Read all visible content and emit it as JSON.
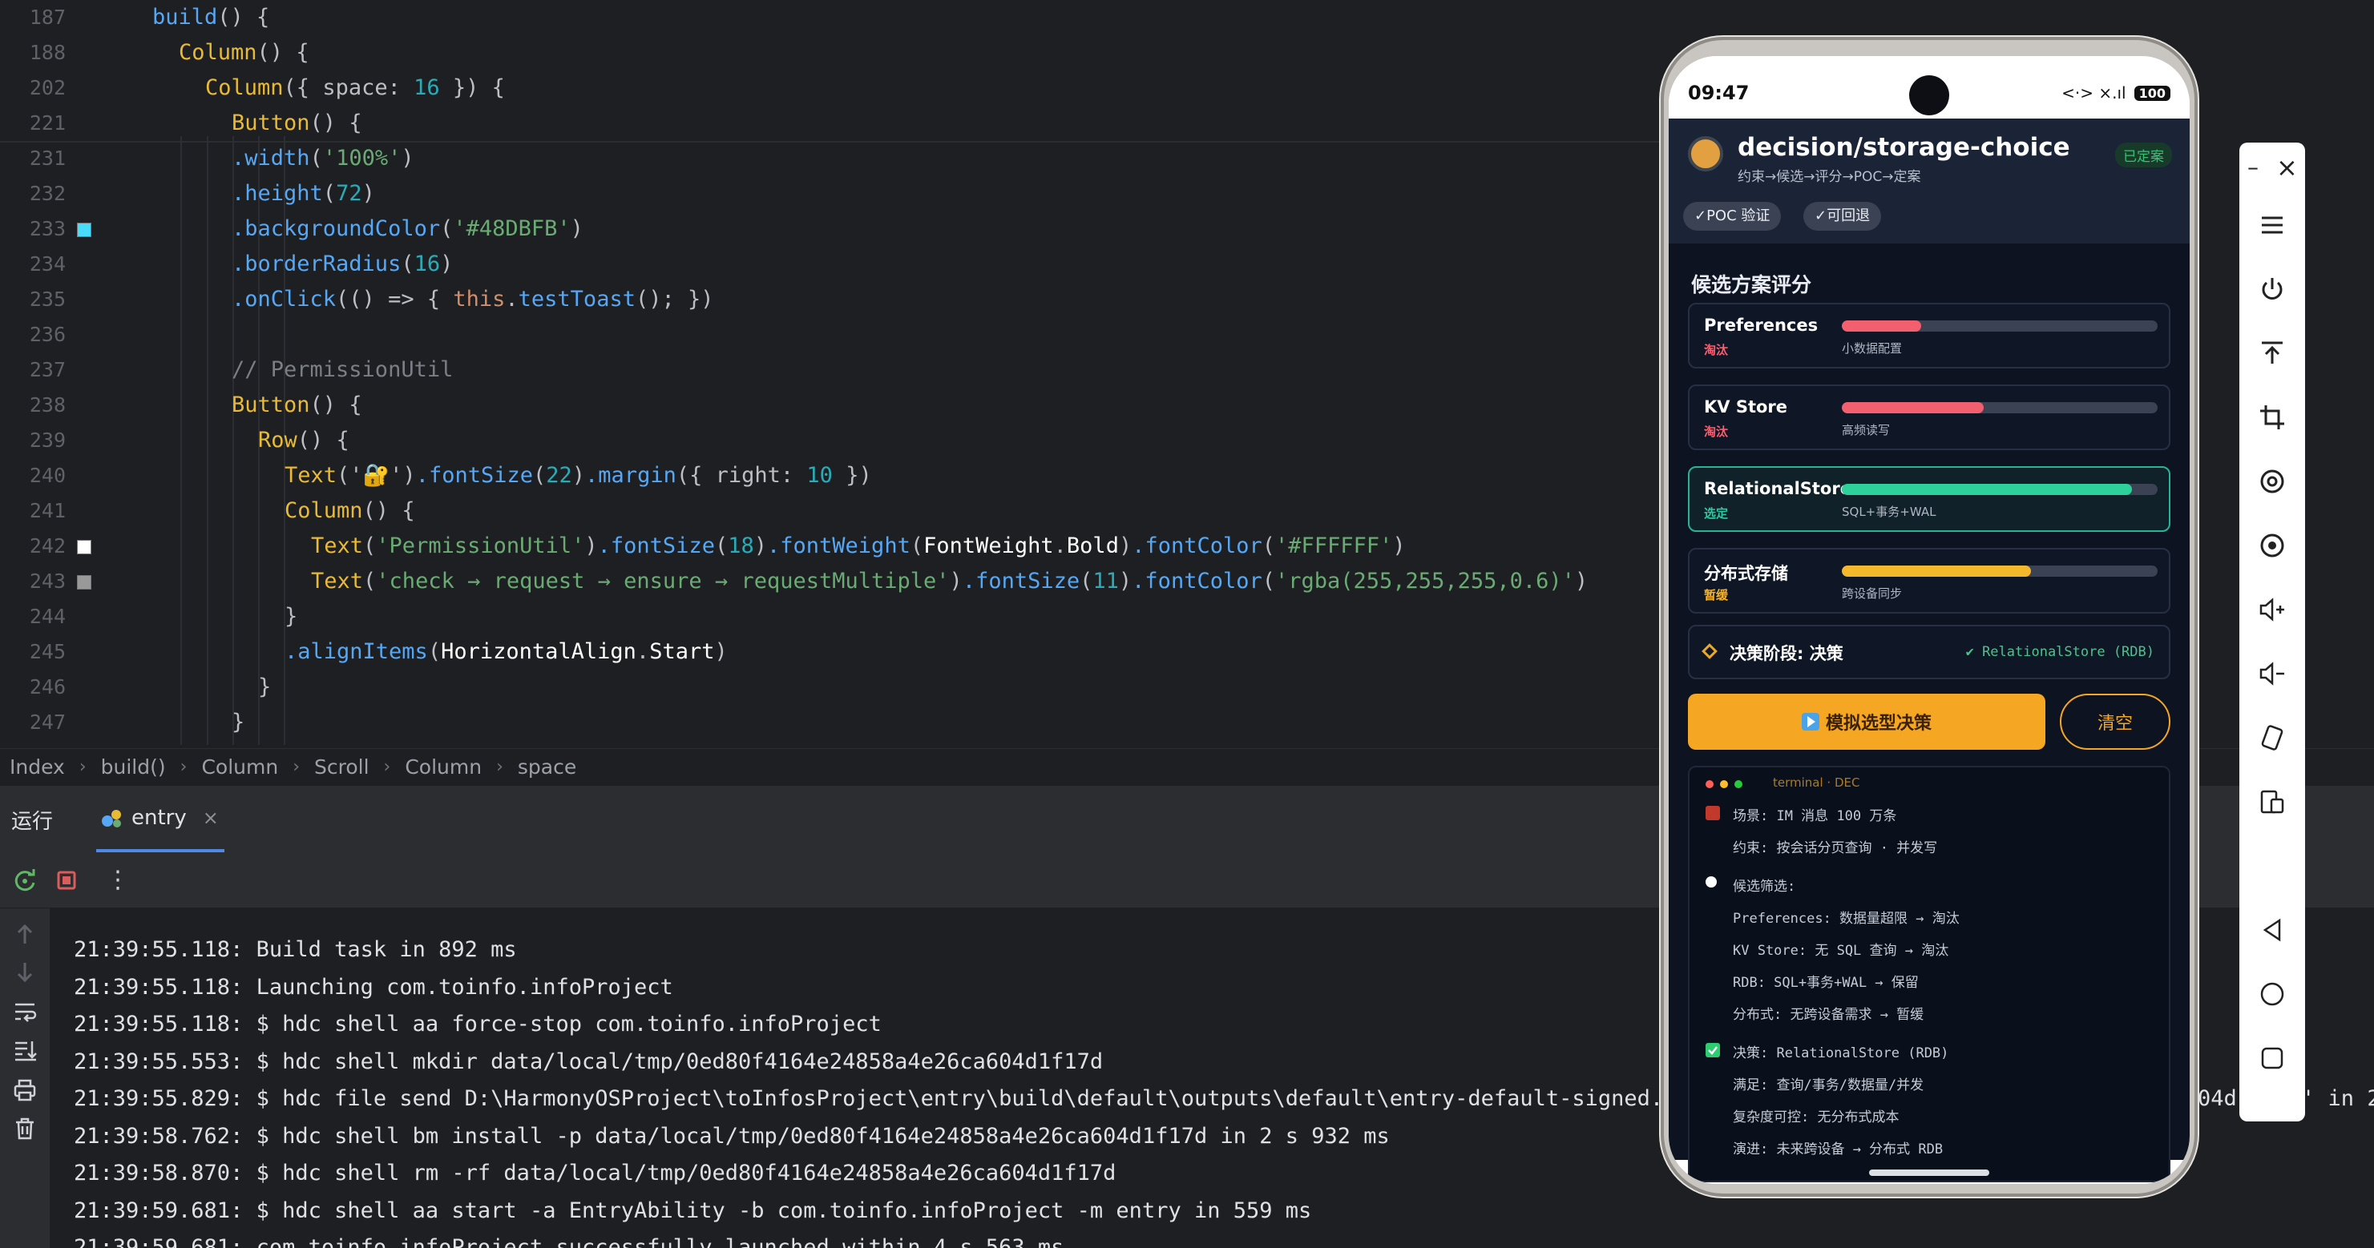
{
  "editor": {
    "lines": [
      {
        "num": "187",
        "indent": 0,
        "segments": [
          [
            "build",
            "fn"
          ],
          [
            "() {",
            "plain"
          ]
        ]
      },
      {
        "num": "188",
        "indent": 1,
        "segments": [
          [
            "Column",
            "y"
          ],
          [
            "() {",
            "plain"
          ]
        ]
      },
      {
        "num": "202",
        "indent": 2,
        "segments": [
          [
            "Column",
            "y"
          ],
          [
            "({ ",
            "plain"
          ],
          [
            "space",
            "plain"
          ],
          [
            ": ",
            "plain"
          ],
          [
            "16",
            "num"
          ],
          [
            " }) {",
            "plain"
          ]
        ]
      },
      {
        "num": "221",
        "indent": 3,
        "segments": [
          [
            "Button",
            "y"
          ],
          [
            "() {",
            "plain"
          ]
        ]
      },
      {
        "num": "231",
        "indent": 3,
        "segments": [
          [
            ".width",
            "fn"
          ],
          [
            "(",
            "plain"
          ],
          [
            "'100%'",
            "str"
          ],
          [
            ")",
            "plain"
          ]
        ]
      },
      {
        "num": "232",
        "indent": 3,
        "segments": [
          [
            ".height",
            "fn"
          ],
          [
            "(",
            "plain"
          ],
          [
            "72",
            "num"
          ],
          [
            ")",
            "plain"
          ]
        ]
      },
      {
        "num": "233",
        "indent": 3,
        "swatch": "#48DBFB",
        "segments": [
          [
            ".backgroundColor",
            "fn"
          ],
          [
            "(",
            "plain"
          ],
          [
            "'#48DBFB'",
            "str"
          ],
          [
            ")",
            "plain"
          ]
        ]
      },
      {
        "num": "234",
        "indent": 3,
        "segments": [
          [
            ".borderRadius",
            "fn"
          ],
          [
            "(",
            "plain"
          ],
          [
            "16",
            "num"
          ],
          [
            ")",
            "plain"
          ]
        ]
      },
      {
        "num": "235",
        "indent": 3,
        "segments": [
          [
            ".onClick",
            "fn"
          ],
          [
            "(() => { ",
            "plain"
          ],
          [
            "this",
            "kw"
          ],
          [
            ".",
            "plain"
          ],
          [
            "testToast",
            "fn"
          ],
          [
            "(); })",
            "plain"
          ]
        ]
      },
      {
        "num": "236",
        "indent": 3,
        "segments": []
      },
      {
        "num": "237",
        "indent": 3,
        "segments": [
          [
            "// PermissionUtil",
            "cm"
          ]
        ]
      },
      {
        "num": "238",
        "indent": 3,
        "segments": [
          [
            "Button",
            "y"
          ],
          [
            "() {",
            "plain"
          ]
        ]
      },
      {
        "num": "239",
        "indent": 4,
        "segments": [
          [
            "Row",
            "y"
          ],
          [
            "() {",
            "plain"
          ]
        ]
      },
      {
        "num": "240",
        "indent": 5,
        "segments": [
          [
            "Text",
            "y"
          ],
          [
            "('",
            "plain"
          ],
          [
            "🔐",
            "plain"
          ],
          [
            "')",
            "plain"
          ],
          [
            ".fontSize",
            "fn"
          ],
          [
            "(",
            "plain"
          ],
          [
            "22",
            "num"
          ],
          [
            ")",
            "plain"
          ],
          [
            ".margin",
            "fn"
          ],
          [
            "({ ",
            "plain"
          ],
          [
            "right",
            "plain"
          ],
          [
            ": ",
            "plain"
          ],
          [
            "10",
            "num"
          ],
          [
            " })",
            "plain"
          ]
        ]
      },
      {
        "num": "241",
        "indent": 5,
        "segments": [
          [
            "Column",
            "y"
          ],
          [
            "() {",
            "plain"
          ]
        ]
      },
      {
        "num": "242",
        "indent": 6,
        "swatch": "#FFFFFF",
        "segments": [
          [
            "Text",
            "y"
          ],
          [
            "(",
            "plain"
          ],
          [
            "'PermissionUtil'",
            "str"
          ],
          [
            ")",
            "plain"
          ],
          [
            ".fontSize",
            "fn"
          ],
          [
            "(",
            "plain"
          ],
          [
            "18",
            "num"
          ],
          [
            ")",
            "plain"
          ],
          [
            ".fontWeight",
            "fn"
          ],
          [
            "(",
            "plain"
          ],
          [
            "FontWeight",
            "wh"
          ],
          [
            ".",
            "plain"
          ],
          [
            "Bold",
            "wh"
          ],
          [
            ")",
            "plain"
          ],
          [
            ".fontColor",
            "fn"
          ],
          [
            "(",
            "plain"
          ],
          [
            "'#FFFFFF'",
            "str"
          ],
          [
            ")",
            "plain"
          ]
        ]
      },
      {
        "num": "243",
        "indent": 6,
        "swatch": "#999999",
        "segments": [
          [
            "Text",
            "y"
          ],
          [
            "(",
            "plain"
          ],
          [
            "'check → request → ensure → requestMultiple'",
            "str"
          ],
          [
            ")",
            "plain"
          ],
          [
            ".fontSize",
            "fn"
          ],
          [
            "(",
            "plain"
          ],
          [
            "11",
            "num"
          ],
          [
            ")",
            "plain"
          ],
          [
            ".fontColor",
            "fn"
          ],
          [
            "(",
            "plain"
          ],
          [
            "'rgba(255,255,255,0.6)'",
            "str"
          ],
          [
            ")",
            "plain"
          ]
        ]
      },
      {
        "num": "244",
        "indent": 5,
        "segments": [
          [
            "}",
            "plain"
          ]
        ]
      },
      {
        "num": "245",
        "indent": 5,
        "segments": [
          [
            ".alignItems",
            "fn"
          ],
          [
            "(",
            "plain"
          ],
          [
            "HorizontalAlign",
            "wh"
          ],
          [
            ".",
            "plain"
          ],
          [
            "Start",
            "wh"
          ],
          [
            ")",
            "plain"
          ]
        ]
      },
      {
        "num": "246",
        "indent": 4,
        "segments": [
          [
            "}",
            "plain"
          ]
        ]
      },
      {
        "num": "247",
        "indent": 3,
        "segments": [
          [
            "}",
            "plain"
          ]
        ]
      }
    ]
  },
  "breadcrumb": [
    "Index",
    "build()",
    "Column",
    "Scroll",
    "Column",
    "space"
  ],
  "run_panel": {
    "title": "运行",
    "tab_label": "entry",
    "close_glyph": "×",
    "more_glyph": "⋮",
    "log": [
      "21:39:55.118: Build task in 892 ms",
      "21:39:55.118: Launching com.toinfo.infoProject",
      "21:39:55.118: $ hdc shell aa force-stop com.toinfo.infoProject",
      "21:39:55.553: $ hdc shell mkdir data/local/tmp/0ed80f4164e24858a4e26ca604d1f17d",
      "21:39:55.829: $ hdc file send D:\\HarmonyOSProject\\toInfosProject\\entry\\build\\default\\outputs\\default\\entry-default-signed.ha",
      "21:39:58.762: $ hdc shell bm install -p data/local/tmp/0ed80f4164e24858a4e26ca604d1f17d in 2 s 932 ms",
      "21:39:58.870: $ hdc shell rm -rf data/local/tmp/0ed80f4164e24858a4e26ca604d1f17d",
      "21:39:59.681: $ hdc shell aa start -a EntryAbility -b com.toinfo.infoProject -m entry in 559 ms",
      "21:39:59.681: com.toinfo.infoProject successfully launched within 4 s 563 ms"
    ],
    "log_overflow": "04d1f17d' in 2"
  },
  "phone": {
    "status": {
      "time": "09:47",
      "icons": "<·> ×.ıl",
      "battery": "100"
    },
    "header": {
      "title": "decision/storage-choice",
      "subtitle": "约束→候选→评分→POC→定案",
      "badge": "已定案",
      "chips": [
        "✓POC 验证",
        "✓可回退"
      ]
    },
    "section_title": "候选方案评分",
    "candidates": [
      {
        "name": "Preferences",
        "status": "淘汰",
        "status_color": "#ff5c6c",
        "bar_color": "#f25f6e",
        "score": 0.25,
        "note": "小数据配置",
        "selected": false
      },
      {
        "name": "KV Store",
        "status": "淘汰",
        "status_color": "#ff5c6c",
        "bar_color": "#f25f6e",
        "score": 0.45,
        "note": "高频读写",
        "selected": false
      },
      {
        "name": "RelationalStore",
        "status": "选定",
        "status_color": "#2ec9a3",
        "bar_color": "#2fd19b",
        "score": 0.92,
        "note": "SQL+事务+WAL",
        "selected": true
      },
      {
        "name": "分布式存储",
        "status": "暂缓",
        "status_color": "#f5b22c",
        "bar_color": "#f5b72c",
        "score": 0.6,
        "note": "跨设备同步",
        "selected": false
      }
    ],
    "phase": {
      "label": "决策阶段: 决策",
      "result": "✔ RelationalStore (RDB)"
    },
    "primary_button": "模拟选型决策",
    "clear_button": "清空",
    "terminal": {
      "title": "terminal · DEC",
      "lines": [
        {
          "mark": "red-square",
          "text": "场景: IM 消息 100 万条"
        },
        {
          "mark": "",
          "text": "约束: 按会话分页查询 · 并发写"
        },
        {
          "mark": "white-dot",
          "text": "候选筛选:"
        },
        {
          "mark": "",
          "text": "Preferences: 数据量超限 → 淘汰"
        },
        {
          "mark": "",
          "text": "KV Store: 无 SQL 查询 → 淘汰"
        },
        {
          "mark": "",
          "text": "RDB: SQL+事务+WAL → 保留"
        },
        {
          "mark": "",
          "text": "分布式: 无跨设备需求 → 暂缓"
        },
        {
          "mark": "green-check",
          "text": "决策: RelationalStore (RDB)"
        },
        {
          "mark": "",
          "text": "满足: 查询/事务/数据量/并发"
        },
        {
          "mark": "",
          "text": "复杂度可控: 无分布式成本"
        },
        {
          "mark": "",
          "text": "演进: 未来跨设备 → 分布式 RDB"
        }
      ]
    }
  },
  "emulator_toolbar": {
    "minimize": "–",
    "close": "×",
    "icons": [
      "menu-icon",
      "power-icon",
      "top-icon",
      "crop-icon",
      "screenshot-icon",
      "record-icon",
      "volume-up-icon",
      "volume-down-icon",
      "rotate-icon",
      "screen-switch-icon",
      "back-icon",
      "home-icon",
      "recents-icon"
    ]
  },
  "colors": {
    "accent": "#4e89e8",
    "brand_orange": "#f5a623"
  }
}
